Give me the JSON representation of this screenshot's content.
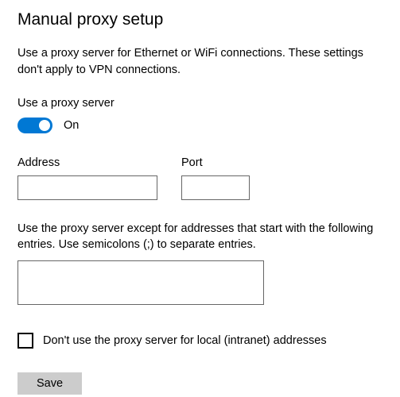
{
  "heading": "Manual proxy setup",
  "description": "Use a proxy server for Ethernet or WiFi connections. These settings don't apply to VPN connections.",
  "toggle": {
    "label": "Use a proxy server",
    "state": "On",
    "on": true
  },
  "address": {
    "label": "Address",
    "value": ""
  },
  "port": {
    "label": "Port",
    "value": ""
  },
  "exceptions": {
    "hint": "Use the proxy server except for addresses that start with the following entries. Use semicolons (;) to separate entries.",
    "value": ""
  },
  "bypass_local": {
    "label": "Don't use the proxy server for local (intranet) addresses",
    "checked": false
  },
  "save_label": "Save"
}
